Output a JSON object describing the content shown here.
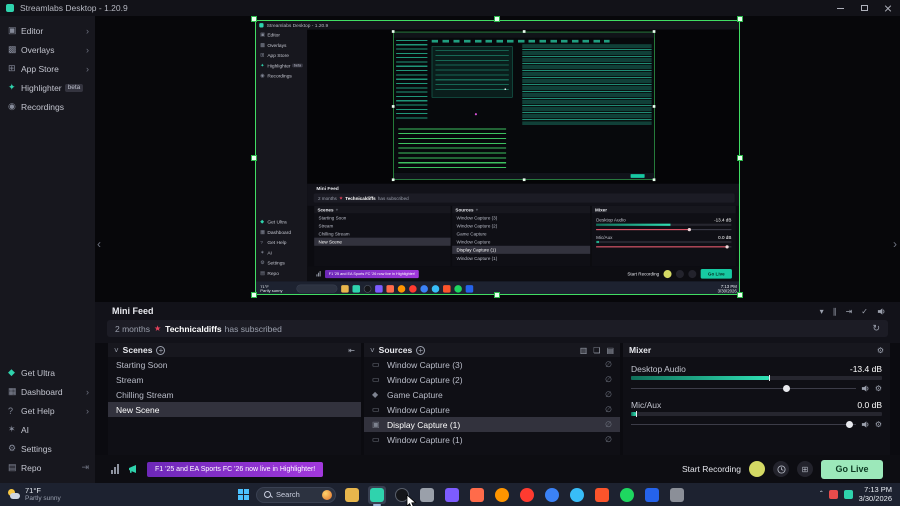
{
  "colors": {
    "accent_teal": "#2fd3ad",
    "selection_green": "#41dd63",
    "go_live_bg": "#9ce8ba",
    "go_live_text": "#0d3b23",
    "notification_purple_1": "#6d28b8",
    "notification_purple_2": "#a238dd",
    "meter_teal_1": "#10705a",
    "meter_teal_2": "#2fe0b4",
    "slider_red": "#e25568",
    "sub_star": "#e8425c",
    "record_yellow": "#d4d964",
    "taskbar_bg": "#1d2230",
    "win_blue": "#4cc2ff"
  },
  "titlebar": {
    "title": "Streamlabs Desktop - 1.20.9"
  },
  "sidebar": {
    "top_items": [
      {
        "label": "Editor",
        "icon_glyph": "▣"
      },
      {
        "label": "Overlays",
        "icon_glyph": "▩"
      },
      {
        "label": "App Store",
        "icon_glyph": "⊞"
      },
      {
        "label": "Highlighter",
        "icon_glyph": "✦",
        "badge": "beta"
      },
      {
        "label": "Recordings",
        "icon_glyph": "◉"
      }
    ],
    "bottom_items": [
      {
        "label": "Get Ultra",
        "icon_glyph": "◆"
      },
      {
        "label": "Dashboard",
        "icon_glyph": "▦"
      },
      {
        "label": "Get Help",
        "icon_glyph": "?"
      },
      {
        "label": "AI",
        "icon_glyph": "✶"
      },
      {
        "label": "Settings",
        "icon_glyph": "⚙"
      },
      {
        "label": "Repo",
        "icon_glyph": "▤",
        "trail_glyph": "⇥"
      }
    ]
  },
  "editor": {
    "collapse_left_glyph": "‹",
    "collapse_right_glyph": "›"
  },
  "minifeed": {
    "title": "Mini Feed",
    "event_time": "2 months",
    "event_user": "Technicaldiffs",
    "event_action": "has subscribed"
  },
  "scenes": {
    "title": "Scenes",
    "items": [
      "Starting Soon",
      "Stream",
      "Chilling Stream",
      "New Scene"
    ],
    "selected_index": 3
  },
  "sources": {
    "title": "Sources",
    "items": [
      {
        "label": "Window Capture (3)",
        "icon_glyph": "▭"
      },
      {
        "label": "Window Capture (2)",
        "icon_glyph": "▭"
      },
      {
        "label": "Game Capture",
        "icon_glyph": "◆"
      },
      {
        "label": "Window Capture",
        "icon_glyph": "▭"
      },
      {
        "label": "Display Capture (1)",
        "icon_glyph": "▣"
      },
      {
        "label": "Window Capture (1)",
        "icon_glyph": "▭"
      }
    ],
    "selected_index": 4
  },
  "mixer": {
    "title": "Mixer",
    "channels": [
      {
        "name": "Desktop Audio",
        "value": "-13.4 dB",
        "meter_pct": 55,
        "slider_pct": 69
      },
      {
        "name": "Mic/Aux",
        "value": "0.0 dB",
        "meter_pct": 2,
        "slider_pct": 97
      }
    ]
  },
  "bottombar": {
    "notification": "F1 '25 and EA Sports FC '26 now live in Highlighter!",
    "start_recording_label": "Start Recording",
    "go_live_label": "Go Live"
  },
  "taskbar": {
    "weather_temp": "71°F",
    "weather_desc": "Partly sunny",
    "search_placeholder": "Search",
    "clock_time": "7:13 PM",
    "clock_date": "3/30/2026"
  },
  "icons": {
    "chevron_right": "›",
    "chevron_down": "˅",
    "add": "+",
    "gear": "⚙",
    "filter": "▾",
    "pause": "∥",
    "skip_end": "⇥",
    "read_all": "✓",
    "refresh": "↻",
    "visibility": "∅",
    "copy": "❏",
    "folder": "▤",
    "monitor": "▥",
    "grid": "⊞",
    "star": "★",
    "collapse": "⇤",
    "tray_chevron": "ˆ"
  }
}
